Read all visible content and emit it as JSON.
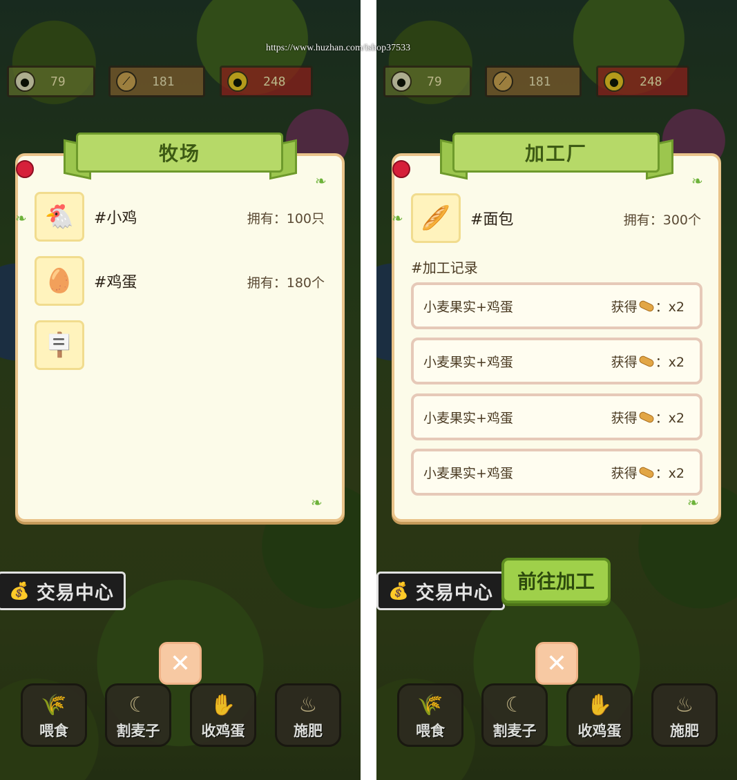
{
  "watermark": "https://www.huzhan.com/ishop37533",
  "resources": {
    "egg": "79",
    "wheat": "181",
    "coin": "248"
  },
  "left_panel": {
    "title": "牧场",
    "items": [
      {
        "icon": "chicken-icon",
        "name": "#小鸡",
        "owned": "拥有：100只"
      },
      {
        "icon": "egg-icon",
        "name": "#鸡蛋",
        "owned": "拥有：180个"
      },
      {
        "icon": "sign-post-icon",
        "name": "",
        "owned": ""
      }
    ]
  },
  "right_panel": {
    "title": "加工厂",
    "item": {
      "icon": "bread-icon",
      "name": "#面包",
      "owned": "拥有：300个"
    },
    "section_label": "#加工记录",
    "records": [
      {
        "recipe": "小麦果实+鸡蛋",
        "gain_prefix": "获得",
        "gain_suffix": "：x2"
      },
      {
        "recipe": "小麦果实+鸡蛋",
        "gain_prefix": "获得",
        "gain_suffix": "：x2"
      },
      {
        "recipe": "小麦果实+鸡蛋",
        "gain_prefix": "获得",
        "gain_suffix": "：x2"
      },
      {
        "recipe": "小麦果实+鸡蛋",
        "gain_prefix": "获得",
        "gain_suffix": "：x2"
      }
    ],
    "go_button": "前往加工"
  },
  "trade_center": "交易中心",
  "close_symbol": "✕",
  "actions": [
    {
      "icon": "wheat-icon",
      "label": "喂食"
    },
    {
      "icon": "sickle-icon",
      "label": "割麦子"
    },
    {
      "icon": "glove-icon",
      "label": "收鸡蛋"
    },
    {
      "icon": "fertilizer-bag-icon",
      "label": "施肥"
    }
  ],
  "colors": {
    "panel_bg": "#fcfbe9",
    "banner": "#b6d968",
    "go_button": "#9fd04a",
    "close_button": "#f7c9a3"
  }
}
